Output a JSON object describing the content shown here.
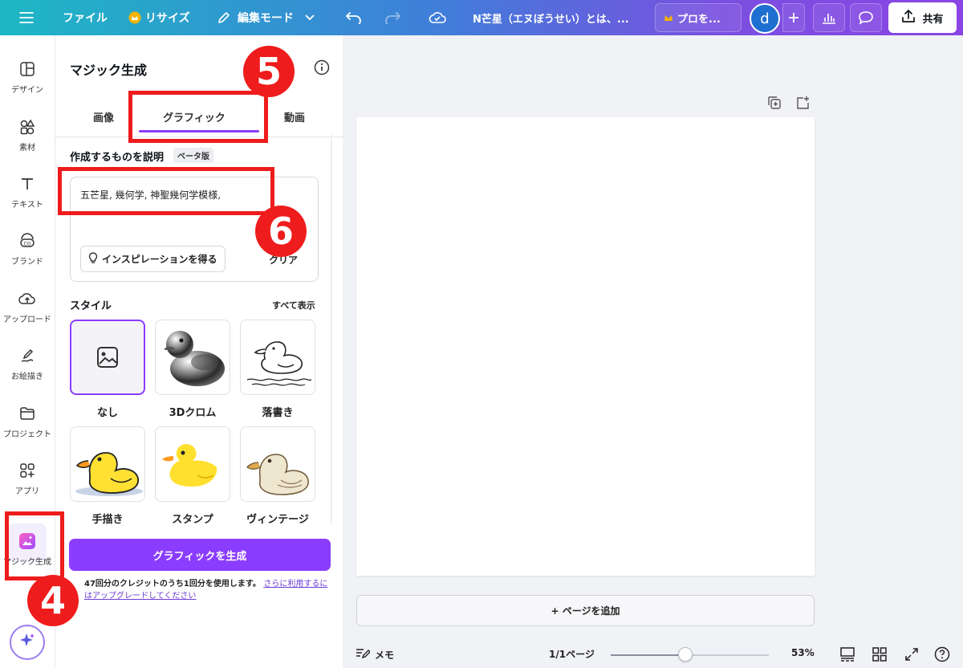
{
  "topbar": {
    "file_label": "ファイル",
    "resize_label": "リサイズ",
    "edit_mode_label": "編集モード",
    "doc_title": "N芒星（エヌぼうせい）とは、...",
    "pro_label": "プロを...",
    "avatar_letter": "d",
    "share_label": "共有"
  },
  "rail": {
    "items": [
      {
        "label": "デザイン",
        "icon": "layout-icon"
      },
      {
        "label": "素材",
        "icon": "shapes-icon"
      },
      {
        "label": "テキスト",
        "icon": "text-icon"
      },
      {
        "label": "ブランド",
        "icon": "brand-icon"
      },
      {
        "label": "アップロード",
        "icon": "upload-cloud-icon"
      },
      {
        "label": "お絵描き",
        "icon": "draw-icon"
      },
      {
        "label": "プロジェクト",
        "icon": "folder-icon"
      },
      {
        "label": "アプリ",
        "icon": "apps-icon"
      },
      {
        "label": "マジック生成",
        "icon": "magic-media-icon"
      }
    ]
  },
  "panel": {
    "title": "マジック生成",
    "tabs": [
      {
        "label": "画像"
      },
      {
        "label": "グラフィック"
      },
      {
        "label": "動画"
      }
    ],
    "active_tab": "グラフィック",
    "describe_label": "作成するものを説明",
    "beta_badge": "ベータ版",
    "prompt_value": "五芒星, 幾何学, 神聖幾何学模様,",
    "inspiration_label": "インスピレーションを得る",
    "clear_label": "クリア",
    "style_label": "スタイル",
    "see_all_label": "すべて表示",
    "styles": [
      {
        "name": "なし"
      },
      {
        "name": "3Dクロム"
      },
      {
        "name": "落書き"
      },
      {
        "name": "手描き"
      },
      {
        "name": "スタンプ"
      },
      {
        "name": "ヴィンテージ"
      }
    ],
    "generate_label": "グラフィックを生成",
    "credit_text": "47回分のクレジットのうち1回分を使用します。",
    "credit_link": "さらに利用するにはアップグレードしてください"
  },
  "canvas": {
    "add_page_label": "+ ページを追加"
  },
  "footer": {
    "notes_label": "メモ",
    "page_indicator": "1/1ページ",
    "zoom_label": "53%",
    "zoom_fraction": 0.47
  },
  "annotations": {
    "badge_4": "4",
    "badge_5": "5",
    "badge_6": "6"
  },
  "colors": {
    "accent": "#8b3dff",
    "annotation_red": "#ee1c1c"
  }
}
